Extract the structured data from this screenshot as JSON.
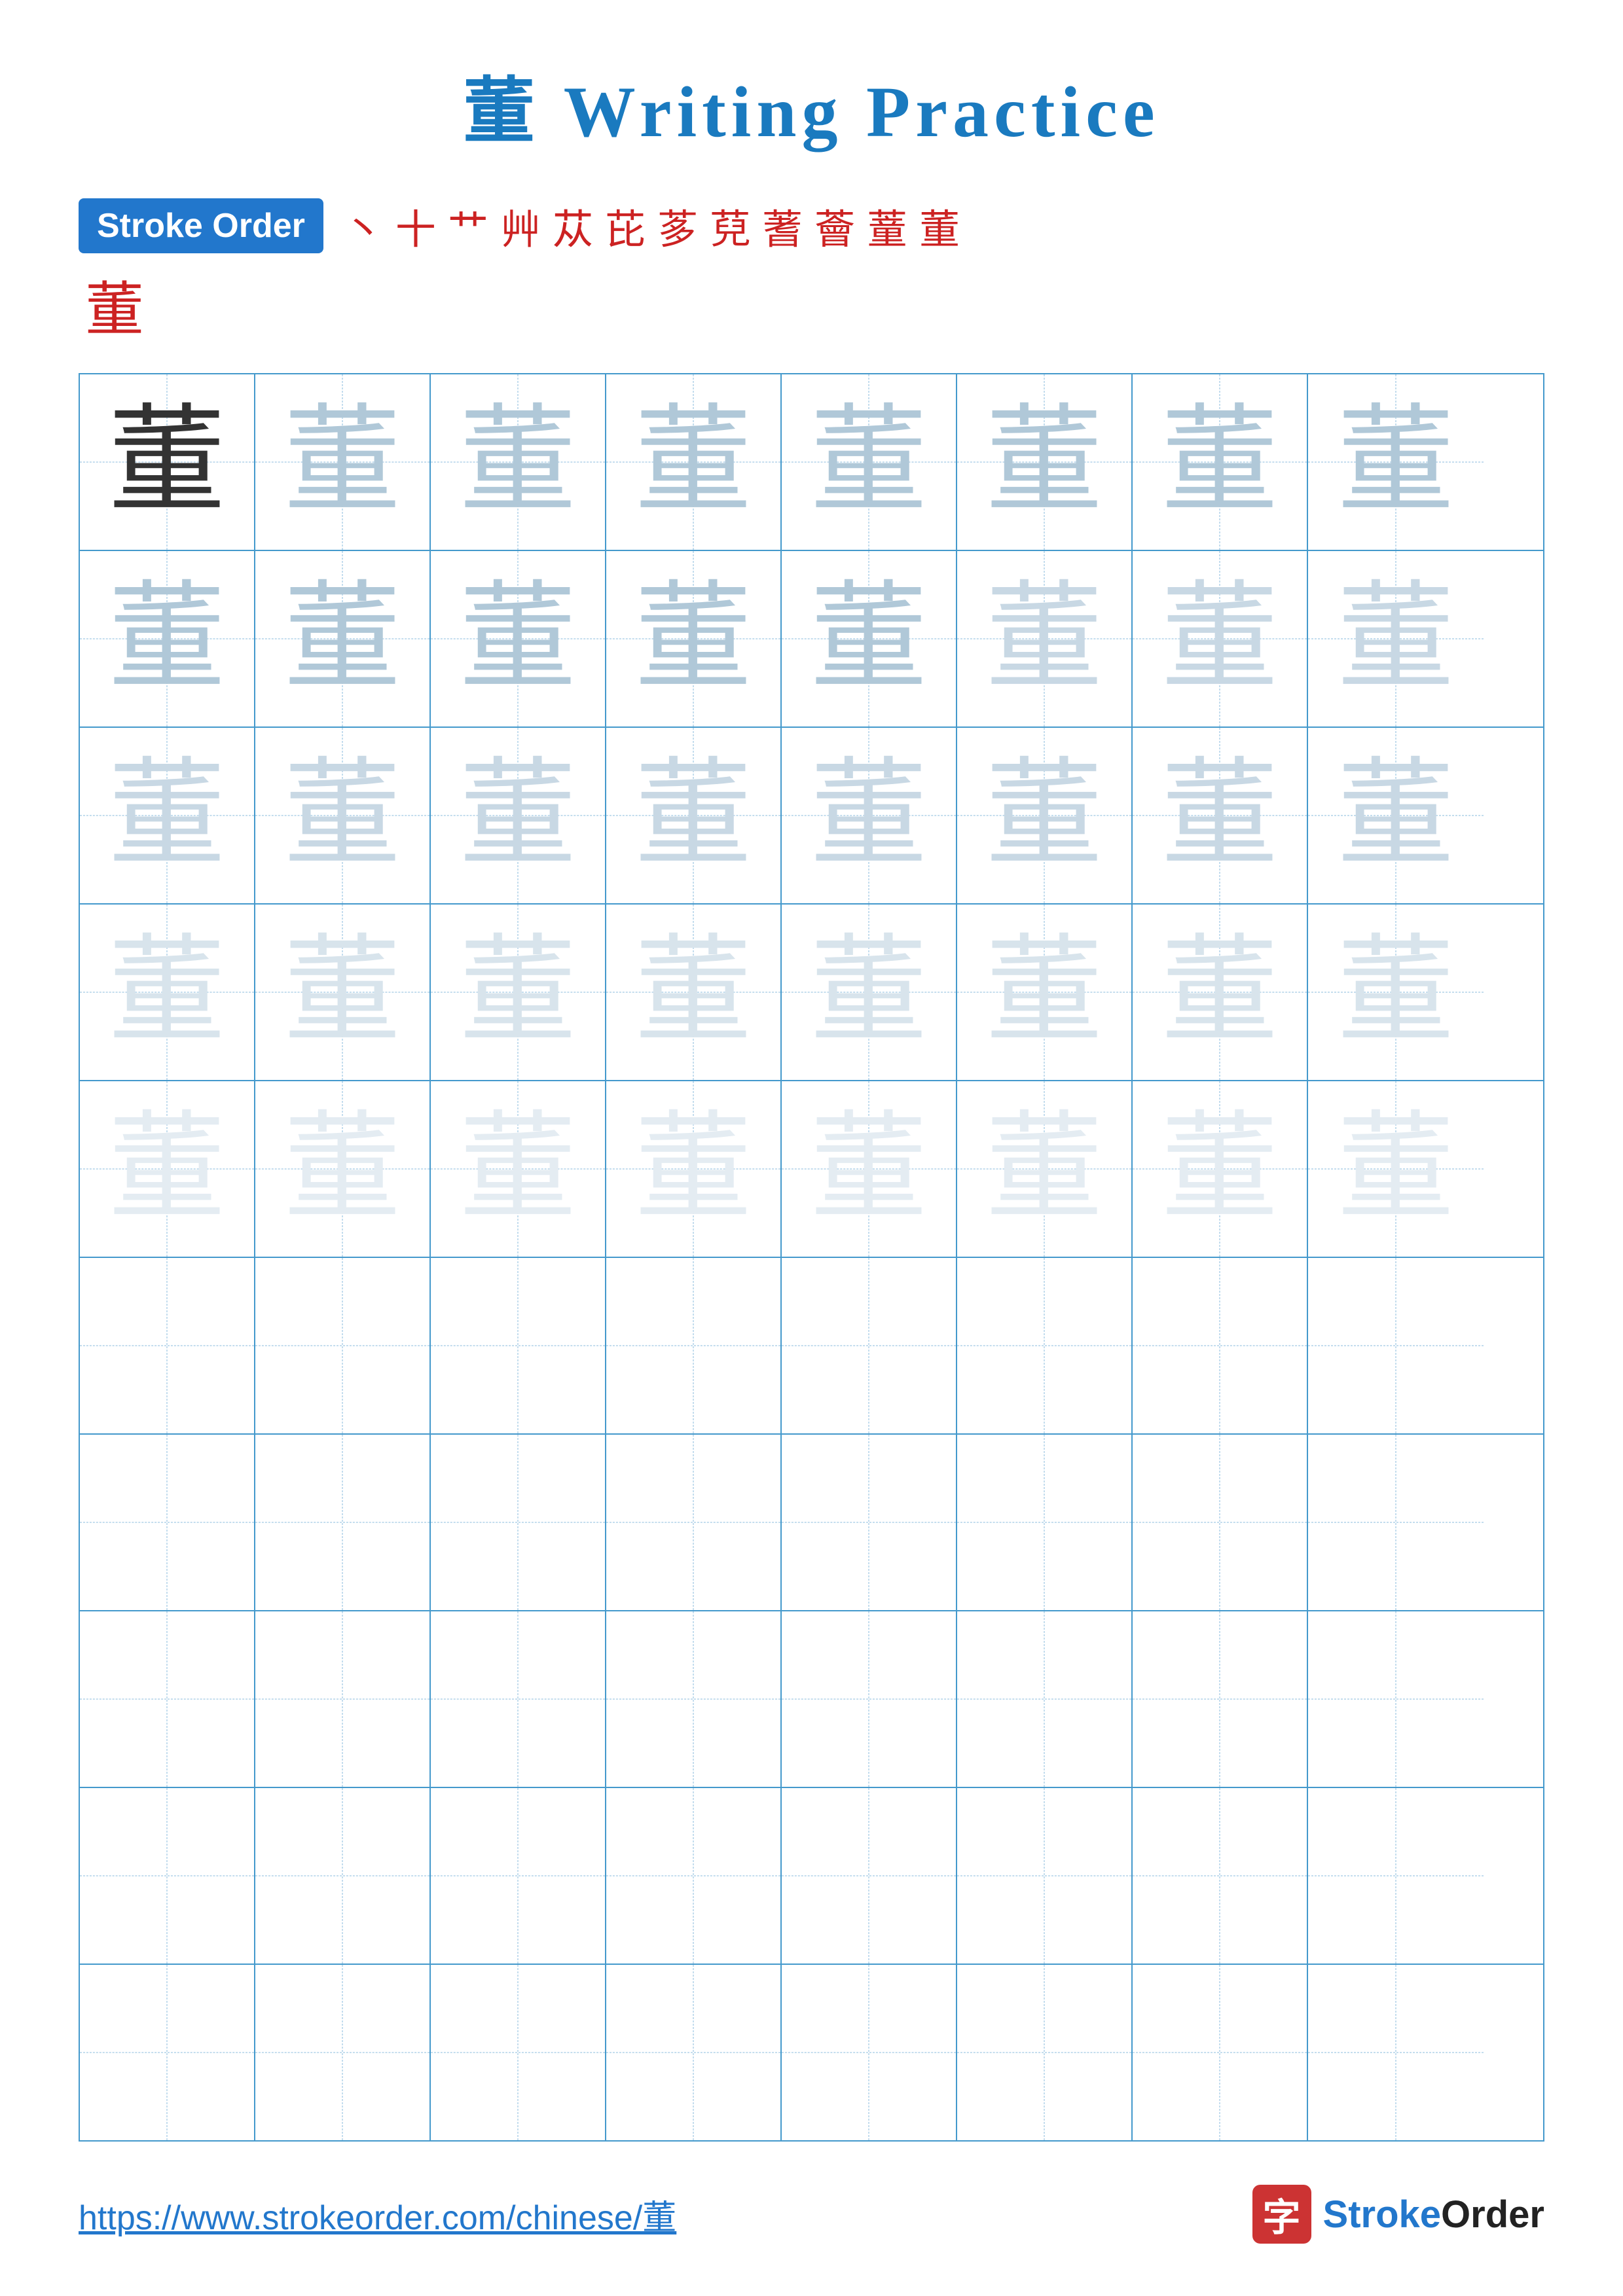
{
  "title": {
    "char": "董",
    "text": " Writing Practice",
    "color": "#1a7abf"
  },
  "stroke_order": {
    "badge_label": "Stroke Order",
    "strokes": [
      "丶",
      "＋",
      "艹",
      "艸",
      "𠂉",
      "茝",
      "莅",
      "葆",
      "蓍",
      "蔦",
      "營",
      "萱"
    ],
    "final_char": "董"
  },
  "grid": {
    "char": "董",
    "rows": 10,
    "cols": 8
  },
  "footer": {
    "url": "https://www.strokeorder.com/chinese/董",
    "logo_char": "字",
    "logo_text_stroke": "Stroke",
    "logo_text_order": "Order"
  }
}
